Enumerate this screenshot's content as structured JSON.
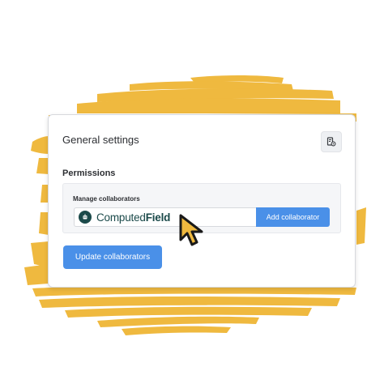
{
  "settings": {
    "title": "General settings",
    "settings_icon": "document-settings-icon",
    "permissions": {
      "heading": "Permissions",
      "manage_label": "Manage collaborators",
      "collaborator_field": {
        "logo_icon": "computedfield-logo-icon",
        "logo_text_regular": "Computed",
        "logo_text_bold": "Field"
      },
      "add_button": "Add collaborator"
    },
    "update_button": "Update collaborators"
  },
  "decoration": {
    "brush_color": "#efb93f",
    "cursor_icon": "mouse-pointer-icon",
    "cursor_color": "#efb93f"
  },
  "colors": {
    "primary_button": "#4a90e8",
    "logo": "#1b4a4a"
  }
}
